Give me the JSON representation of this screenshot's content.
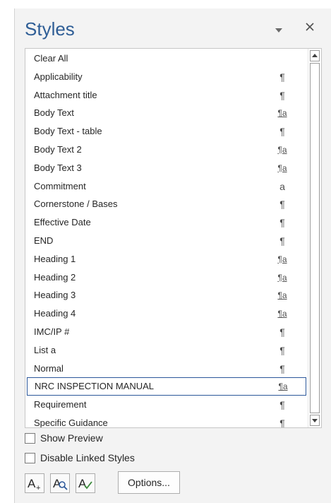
{
  "pane": {
    "title": "Styles"
  },
  "styles": [
    {
      "name": "Clear All",
      "mark": ""
    },
    {
      "name": "Applicability",
      "mark": "¶"
    },
    {
      "name": "Attachment title",
      "mark": "¶"
    },
    {
      "name": "Body Text",
      "mark": "¶a"
    },
    {
      "name": "Body Text - table",
      "mark": "¶"
    },
    {
      "name": "Body Text 2",
      "mark": "¶a"
    },
    {
      "name": "Body Text 3",
      "mark": "¶a"
    },
    {
      "name": "Commitment",
      "mark": "a"
    },
    {
      "name": "Cornerstone / Bases",
      "mark": "¶"
    },
    {
      "name": "Effective Date",
      "mark": "¶"
    },
    {
      "name": "END",
      "mark": "¶"
    },
    {
      "name": "Heading 1",
      "mark": "¶a"
    },
    {
      "name": "Heading 2",
      "mark": "¶a"
    },
    {
      "name": "Heading 3",
      "mark": "¶a"
    },
    {
      "name": "Heading 4",
      "mark": "¶a"
    },
    {
      "name": "IMC/IP #",
      "mark": "¶"
    },
    {
      "name": "List a",
      "mark": "¶"
    },
    {
      "name": "Normal",
      "mark": "¶"
    },
    {
      "name": "NRC INSPECTION MANUAL",
      "mark": "¶a"
    },
    {
      "name": "Requirement",
      "mark": "¶"
    },
    {
      "name": "Specific Guidance",
      "mark": "¶"
    }
  ],
  "selected_style": "NRC INSPECTION MANUAL",
  "options": {
    "show_preview": {
      "label": "Show Preview",
      "checked": false
    },
    "disable_linked": {
      "label": "Disable Linked Styles",
      "checked": false
    }
  },
  "toolbar": {
    "new_style_icon": "new-style-icon",
    "style_inspector_icon": "style-inspector-icon",
    "manage_styles_icon": "manage-styles-icon",
    "options_label": "Options..."
  },
  "colors": {
    "title": "#2f5e96",
    "selection_border": "#2b579a"
  }
}
